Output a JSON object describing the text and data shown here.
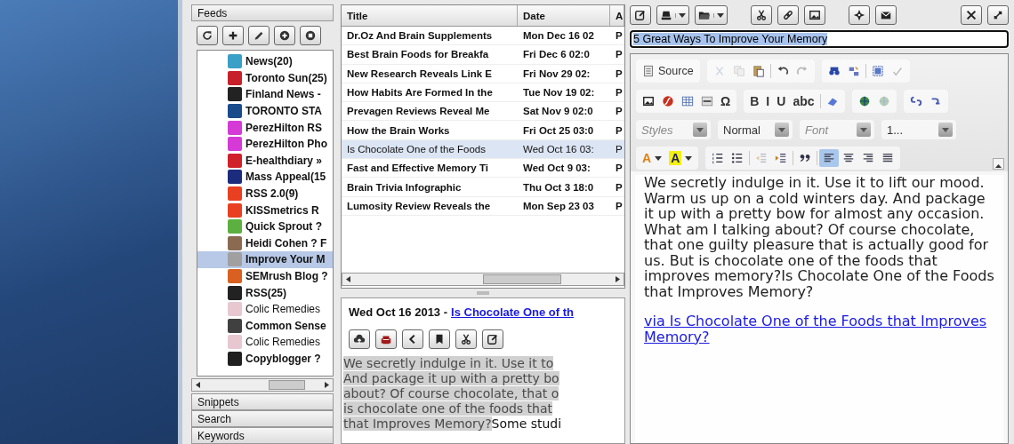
{
  "feeds_panel": {
    "title": "Feeds",
    "toolbar": [
      {
        "kind": "refresh"
      },
      {
        "kind": "plus"
      },
      {
        "kind": "pencil"
      },
      {
        "kind": "circle-plus"
      },
      {
        "kind": "circle-stop"
      }
    ],
    "items": [
      {
        "name": "News(20)",
        "color": "#3aa0c8",
        "unread": true,
        "selected": false
      },
      {
        "name": "Toronto Sun(25)",
        "color": "#c8202a",
        "unread": true,
        "selected": false
      },
      {
        "name": "Finland News -",
        "color": "#222222",
        "unread": true,
        "selected": false
      },
      {
        "name": "TORONTO STA",
        "color": "#1a4c8c",
        "unread": true,
        "selected": false
      },
      {
        "name": "PerezHilton RS",
        "color": "#d63ad6",
        "unread": true,
        "selected": false
      },
      {
        "name": "PerezHilton Pho",
        "color": "#d63ad6",
        "unread": true,
        "selected": false
      },
      {
        "name": "E-healthdiary »",
        "color": "#d0202a",
        "unread": true,
        "selected": false
      },
      {
        "name": "Mass Appeal(15",
        "color": "#1c2c7c",
        "unread": true,
        "selected": false
      },
      {
        "name": "RSS 2.0(9)",
        "color": "#e84020",
        "unread": true,
        "selected": false
      },
      {
        "name": "KISSmetrics R",
        "color": "#e84020",
        "unread": true,
        "selected": false
      },
      {
        "name": "Quick Sprout ?",
        "color": "#5cb040",
        "unread": true,
        "selected": false
      },
      {
        "name": "Heidi Cohen ? F",
        "color": "#8a6a50",
        "unread": true,
        "selected": false
      },
      {
        "name": "Improve Your M",
        "color": "#a0a0a0",
        "unread": true,
        "selected": true
      },
      {
        "name": "SEMrush Blog ?",
        "color": "#d86020",
        "unread": true,
        "selected": false
      },
      {
        "name": "RSS(25)",
        "color": "#222222",
        "unread": true,
        "selected": false
      },
      {
        "name": "Colic Remedies",
        "color": "#e8c8d0",
        "unread": false,
        "selected": false
      },
      {
        "name": "Common Sense",
        "color": "#404040",
        "unread": true,
        "selected": false
      },
      {
        "name": "Colic Remedies",
        "color": "#e8c8d0",
        "unread": false,
        "selected": false
      },
      {
        "name": "Copyblogger ?",
        "color": "#202020",
        "unread": true,
        "selected": false
      }
    ],
    "sections": [
      "Snippets",
      "Search",
      "Keywords"
    ]
  },
  "articles": {
    "columns": [
      "Title",
      "Date",
      "A"
    ],
    "rows": [
      {
        "title": "Dr.Oz And Brain Supplements",
        "date": "Mon Dec 16 02",
        "column_3": "P",
        "unread": true,
        "selected": false
      },
      {
        "title": "Best Brain Foods for Breakfa",
        "date": "Fri Dec 6 02:0",
        "column_3": "P",
        "unread": true,
        "selected": false
      },
      {
        "title": "New Research Reveals Link E",
        "date": "Fri Nov 29 02:",
        "column_3": "P",
        "unread": true,
        "selected": false
      },
      {
        "title": "How Habits Are Formed In the",
        "date": "Tue Nov 19 02:",
        "column_3": "P",
        "unread": true,
        "selected": false
      },
      {
        "title": "Prevagen Reviews Reveal Me",
        "date": "Sat Nov 9 02:0",
        "column_3": "P",
        "unread": true,
        "selected": false
      },
      {
        "title": "How the Brain Works",
        "date": "Fri Oct 25 03:0",
        "column_3": "P",
        "unread": true,
        "selected": false
      },
      {
        "title": "Is Chocolate One of the Foods",
        "date": "Wed Oct 16 03:",
        "column_3": "P",
        "unread": false,
        "selected": true
      },
      {
        "title": "Fast and Effective Memory Ti",
        "date": "Wed Oct 9 03:",
        "column_3": "P",
        "unread": true,
        "selected": false
      },
      {
        "title": "Brain Trivia Infographic",
        "date": "Thu Oct 3 18:0",
        "column_3": "P",
        "unread": true,
        "selected": false
      },
      {
        "title": "Lumosity Review Reveals the",
        "date": "Mon Sep 23 03",
        "column_3": "P",
        "unread": true,
        "selected": false
      }
    ]
  },
  "preview": {
    "date": "Wed Oct 16 2013 -",
    "link": "Is Chocolate One of th",
    "toolbar": [
      {
        "kind": "cloud-up"
      },
      {
        "kind": "sofa"
      },
      {
        "kind": "chevron-left"
      },
      {
        "kind": "bookmark"
      },
      {
        "kind": "scissors"
      },
      {
        "kind": "edit"
      }
    ],
    "highlighted_text": "We secretly indulge in it. Use it to\nAnd package it up with a pretty bo\nabout? Of course chocolate, that o\nis chocolate one of the foods that\nthat Improves Memory?",
    "text": "Some studi"
  },
  "editor": {
    "toolbar": [
      {
        "kind": "edit",
        "dropdown": false
      },
      {
        "kind": "drive",
        "dropdown": true
      },
      {
        "kind": "folder",
        "dropdown": true
      },
      {
        "kind": "gap"
      },
      {
        "kind": "scissors",
        "dropdown": false
      },
      {
        "kind": "link",
        "dropdown": false
      },
      {
        "kind": "image",
        "dropdown": false
      },
      {
        "kind": "gap"
      },
      {
        "kind": "crosshair",
        "dropdown": false
      },
      {
        "kind": "mail",
        "dropdown": false
      },
      {
        "kind": "spacer"
      },
      {
        "kind": "tools",
        "dropdown": false
      },
      {
        "kind": "expand",
        "dropdown": false
      }
    ],
    "title_field": {
      "value": "5 Great Ways To Improve Your Memory"
    },
    "rte_toolbar": [
      [
        [
          {
            "kind": "document",
            "label": "Source",
            "disabled": false
          }
        ],
        [
          {
            "kind": "cut",
            "disabled": true
          },
          {
            "kind": "copy",
            "disabled": true
          },
          {
            "kind": "paste",
            "disabled": false
          },
          {
            "kind": "sep"
          },
          {
            "kind": "undo",
            "disabled": false
          },
          {
            "kind": "redo",
            "disabled": true
          }
        ],
        [
          {
            "kind": "binoculars",
            "disabled": false
          },
          {
            "kind": "replace",
            "disabled": false
          },
          {
            "kind": "sep"
          },
          {
            "kind": "select-all",
            "disabled": false
          },
          {
            "kind": "spellcheck",
            "disabled": true
          }
        ]
      ],
      [
        [
          {
            "kind": "image",
            "disabled": false
          },
          {
            "kind": "flash",
            "disabled": false
          },
          {
            "kind": "table",
            "disabled": false
          },
          {
            "kind": "hr",
            "disabled": false
          },
          {
            "kind": "text",
            "label": "Ω",
            "disabled": false
          }
        ],
        [
          {
            "kind": "text",
            "label": "B",
            "disabled": false
          },
          {
            "kind": "text",
            "label": "I",
            "disabled": false
          },
          {
            "kind": "text",
            "label": "U",
            "disabled": false
          },
          {
            "kind": "text",
            "label": "abc",
            "disabled": false
          },
          {
            "kind": "sep"
          },
          {
            "kind": "eraser",
            "disabled": false
          }
        ],
        [
          {
            "kind": "globe",
            "disabled": false
          },
          {
            "kind": "globe",
            "disabled": true
          }
        ],
        [
          {
            "kind": "chain",
            "disabled": false
          },
          {
            "kind": "chain-break",
            "disabled": false
          }
        ]
      ],
      [
        [
          {
            "kind": "combo",
            "placeholder": "Styles"
          }
        ],
        [
          {
            "kind": "combo",
            "value": "Normal"
          }
        ],
        [
          {
            "kind": "combo",
            "placeholder": "Font"
          }
        ],
        [
          {
            "kind": "combo",
            "value": "1..."
          }
        ]
      ],
      [
        [
          {
            "kind": "color",
            "label": "A",
            "disabled": false
          },
          {
            "kind": "highlight",
            "label": "A",
            "disabled": false
          }
        ],
        [
          {
            "kind": "numbered-list",
            "disabled": false
          },
          {
            "kind": "bullet-list",
            "disabled": false
          },
          {
            "kind": "sep"
          },
          {
            "kind": "outdent",
            "disabled": true
          },
          {
            "kind": "indent",
            "disabled": false
          },
          {
            "kind": "sep"
          },
          {
            "kind": "quote",
            "disabled": false
          },
          {
            "kind": "sep"
          },
          {
            "kind": "align-left",
            "disabled": false,
            "selected": true
          },
          {
            "kind": "align-center",
            "disabled": false,
            "selected": false
          },
          {
            "kind": "align-right",
            "disabled": false,
            "selected": false
          },
          {
            "kind": "justify",
            "disabled": false,
            "selected": false
          }
        ]
      ]
    ],
    "content": {
      "paragraph": "We secretly indulge in it. Use it to lift our mood. Warm us up on a cold winters day. And package it up with a pretty bow for almost any occasion. What am I talking about? Of course chocolate, that one guilty pleasure that is actually good for us. But is chocolate one of the foods that improves memory?Is Chocolate One of the Foods that Improves Memory?",
      "link": "via Is Chocolate One of the Foods that Improves Memory?"
    }
  }
}
